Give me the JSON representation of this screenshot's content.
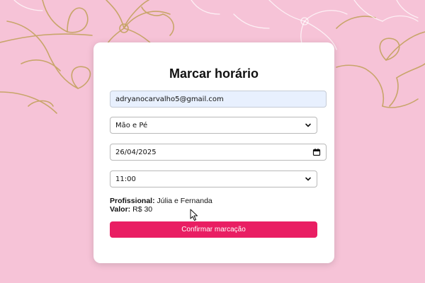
{
  "form": {
    "title": "Marcar horário",
    "email_value": "adryanocarvalho5@gmail.com",
    "service_value": "Mão e Pé",
    "date_value": "26/04/2025",
    "time_value": "11:00",
    "professional_label": "Profissional:",
    "professional_value": "Júlia e Fernanda",
    "price_label": "Valor:",
    "price_value": "R$ 30",
    "confirm_label": "Confirmar marcação"
  },
  "colors": {
    "background": "#f6c3d7",
    "accent": "#e91e63",
    "email_autofill_bg": "#e8f0fe",
    "floral_gold": "#c8a56a"
  },
  "icons": {
    "select_chevron": "chevron-down-icon",
    "date_picker": "calendar-icon",
    "cursor": "mouse-pointer-icon"
  }
}
